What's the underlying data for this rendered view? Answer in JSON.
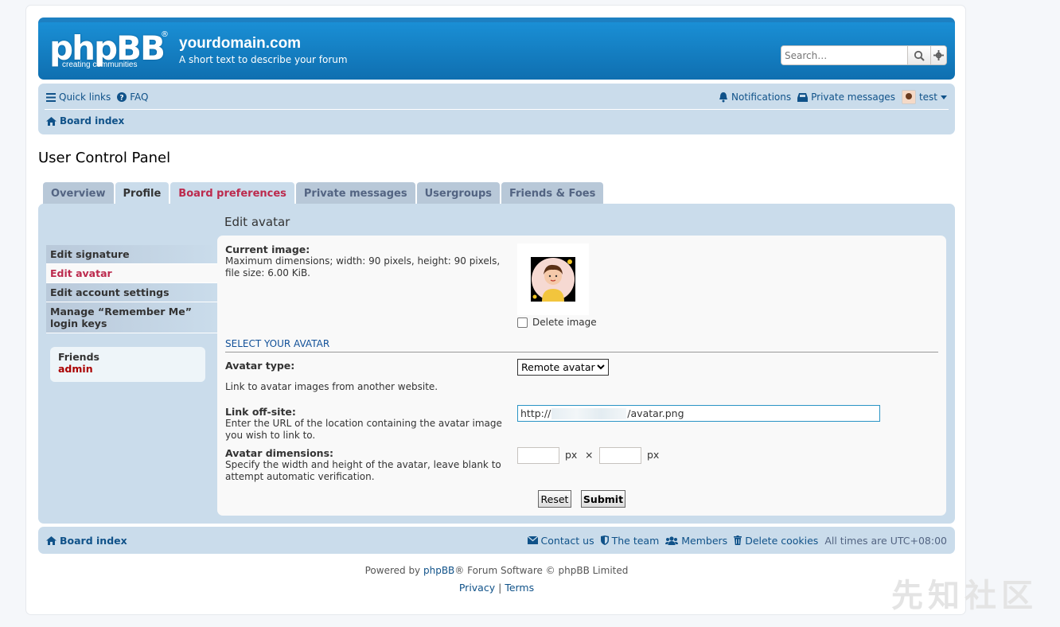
{
  "header": {
    "logo": "phpBB",
    "logo_tagline": "creating   communities",
    "site_name": "yourdomain.com",
    "site_desc": "A short text to describe your forum",
    "search_placeholder": "Search…"
  },
  "navbar": {
    "quick_links": "Quick links",
    "faq": "FAQ",
    "notifications": "Notifications",
    "private_messages": "Private messages",
    "username": "test",
    "board_index": "Board index"
  },
  "page_title": "User Control Panel",
  "tabs": [
    "Overview",
    "Profile",
    "Board preferences",
    "Private messages",
    "Usergroups",
    "Friends & Foes"
  ],
  "sidebar": {
    "items": [
      "Edit signature",
      "Edit avatar",
      "Edit account settings",
      "Manage “Remember Me” login keys"
    ],
    "friends_title": "Friends",
    "friends_user": "admin"
  },
  "form": {
    "title": "Edit avatar",
    "current_image_label": "Current image:",
    "current_image_desc": "Maximum dimensions; width: 90 pixels, height: 90 pixels, file size: 6.00 KiB.",
    "delete_image": "Delete image",
    "section": "SELECT YOUR AVATAR",
    "avatar_type_label": "Avatar type:",
    "avatar_type_value": "Remote avatar",
    "avatar_type_desc": "Link to avatar images from another website.",
    "link_label": "Link off-site:",
    "link_desc": "Enter the URL of the location containing the avatar image you wish to link to.",
    "link_prefix": "http://",
    "link_suffix": "/avatar.png",
    "dims_label": "Avatar dimensions:",
    "dims_desc": "Specify the width and height of the avatar, leave blank to attempt automatic verification.",
    "px": "px",
    "times": "×",
    "reset": "Reset",
    "submit": "Submit"
  },
  "footer": {
    "board_index": "Board index",
    "contact": "Contact us",
    "team": "The team",
    "members": "Members",
    "delete_cookies": "Delete cookies",
    "timezone": "All times are UTC+08:00",
    "powered_prefix": "Powered by ",
    "powered_link": "phpBB",
    "powered_suffix": "® Forum Software © phpBB Limited",
    "privacy": "Privacy",
    "sep": "|",
    "terms": "Terms"
  },
  "watermark": "先知社区"
}
